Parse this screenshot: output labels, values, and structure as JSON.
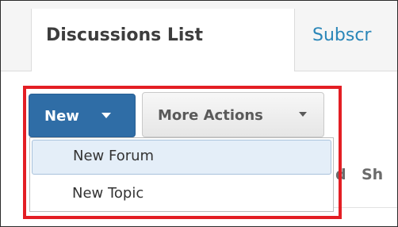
{
  "tabs": {
    "active_label": "Discussions List",
    "other_label": "Subscr"
  },
  "toolbar": {
    "new_label": "New",
    "more_actions_label": "More Actions"
  },
  "dropdown": {
    "items": [
      {
        "label": "New Forum"
      },
      {
        "label": "New Topic"
      }
    ]
  },
  "background": {
    "text_fragment_1": "d",
    "text_fragment_2": "Sh"
  },
  "colors": {
    "accent_button": "#2f6da6",
    "link_blue": "#2a86b8",
    "highlight_red": "#e31e24",
    "menu_hover": "#e4eef8"
  },
  "icons": {
    "new_caret": "caret-down-icon",
    "more_caret": "caret-down-icon"
  }
}
